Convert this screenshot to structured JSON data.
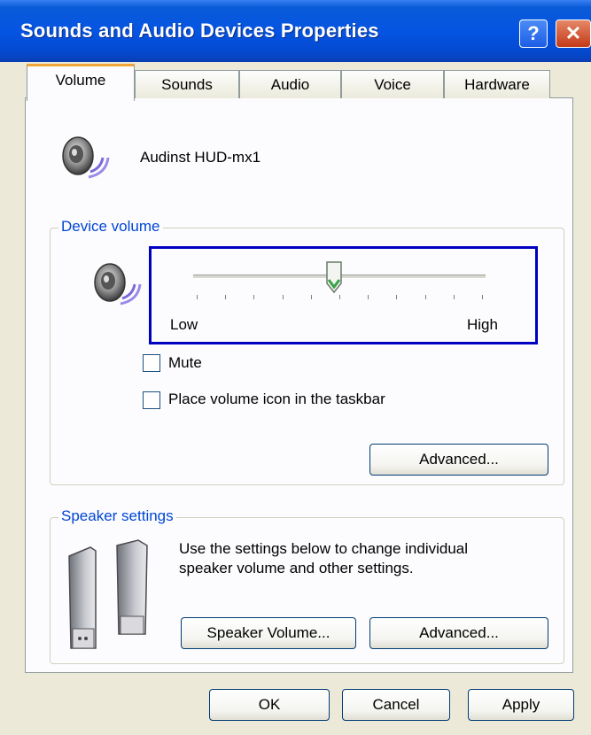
{
  "window": {
    "title": "Sounds and Audio Devices Properties"
  },
  "titlebar": {
    "help_label": "?",
    "close_label": "✕"
  },
  "tabs": [
    {
      "label": "Volume",
      "active": true
    },
    {
      "label": "Sounds",
      "active": false
    },
    {
      "label": "Audio",
      "active": false
    },
    {
      "label": "Voice",
      "active": false
    },
    {
      "label": "Hardware",
      "active": false
    }
  ],
  "device": {
    "name": "Audinst HUD-mx1",
    "icon": "speaker-icon"
  },
  "device_volume": {
    "legend": "Device volume",
    "slider": {
      "low_label": "Low",
      "high_label": "High",
      "value_fraction": 0.48,
      "tick_count": 11
    },
    "mute_label": "Mute",
    "mute_checked": false,
    "taskbar_label": "Place volume icon in the taskbar",
    "taskbar_checked": false,
    "advanced_label": "Advanced..."
  },
  "speaker_settings": {
    "legend": "Speaker settings",
    "description_line1": "Use the settings below to change individual",
    "description_line2": "speaker volume and other settings.",
    "speaker_volume_label": "Speaker Volume...",
    "advanced_label": "Advanced..."
  },
  "footer": {
    "ok_label": "OK",
    "cancel_label": "Cancel",
    "apply_label": "Apply"
  },
  "colors": {
    "titlebar": "#0554e3",
    "accent_tab": "#f1a537",
    "legend": "#0046d5",
    "focus": "#0000c0"
  }
}
